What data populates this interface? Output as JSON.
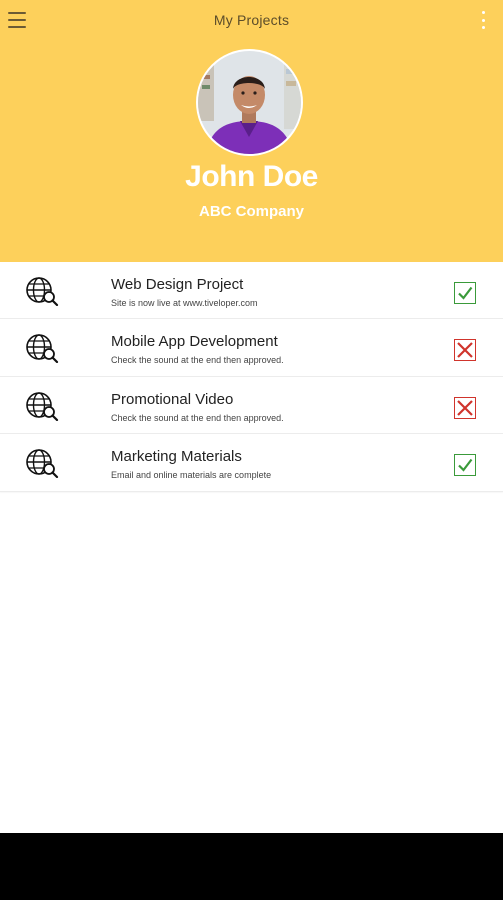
{
  "app_bar": {
    "title": "My Projects",
    "menu_icon": "hamburger-menu-icon",
    "more_icon": "more-vertical-icon"
  },
  "profile": {
    "name": "John Doe",
    "company": "ABC Company",
    "avatar_icon": "profile-photo"
  },
  "projects": [
    {
      "title": "Web Design Project",
      "subtitle": "Site is now live at www.tiveloper.com",
      "status": "approved",
      "status_icon": "checkmark-icon"
    },
    {
      "title": "Mobile App Development",
      "subtitle": "Check the sound at the end then approved.",
      "status": "rejected",
      "status_icon": "x-mark-icon"
    },
    {
      "title": "Promotional Video",
      "subtitle": "Check the sound at the end then approved.",
      "status": "rejected",
      "status_icon": "x-mark-icon"
    },
    {
      "title": "Marketing Materials",
      "subtitle": "Email and online materials are complete",
      "status": "approved",
      "status_icon": "checkmark-icon"
    }
  ],
  "colors": {
    "header_bg": "#fdd05b",
    "approved": "#3a9a3a",
    "rejected": "#d0342c",
    "nav_bar": "#000000"
  }
}
